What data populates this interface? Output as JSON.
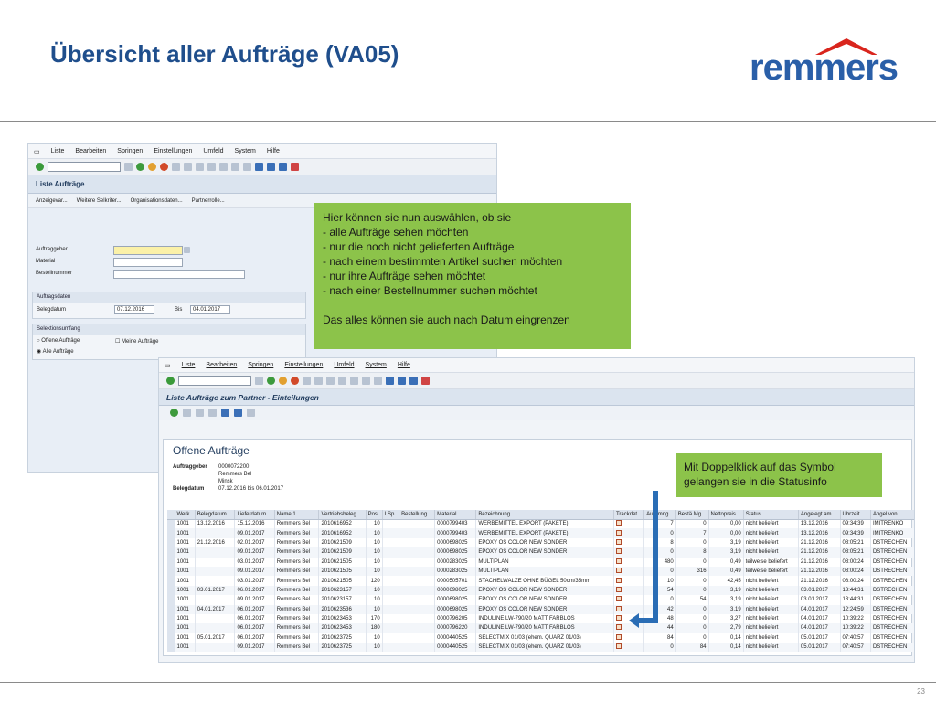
{
  "slide": {
    "title": "Übersicht aller Aufträge (VA05)",
    "logo": "remmers",
    "page_number": "23"
  },
  "sap1": {
    "menu": [
      "Liste",
      "Bearbeiten",
      "Springen",
      "Einstellungen",
      "Umfeld",
      "System",
      "Hilfe"
    ],
    "title": "Liste Aufträge",
    "appbar": [
      "Anzeigevar...",
      "Weitere Selkriter...",
      "Organisationsdaten...",
      "Partnerrolle..."
    ],
    "fields": {
      "auftraggeber_label": "Auftraggeber",
      "material_label": "Material",
      "bestellnummer_label": "Bestellnummer"
    },
    "auftragsdaten": {
      "title": "Auftragsdaten",
      "belegdatum_label": "Belegdatum",
      "from": "07.12.2016",
      "bis_label": "Bis",
      "to": "04.01.2017"
    },
    "selektion": {
      "title": "Selektionsumfang",
      "offene": "Offene Aufträge",
      "meine": "Meine Aufträge",
      "alle": "Alle Aufträge"
    }
  },
  "callout1": {
    "lines": [
      "Hier können sie nun auswählen, ob sie",
      "- alle Aufträge sehen möchten",
      "- nur die noch nicht gelieferten Aufträge",
      "- nach einem bestimmten Artikel suchen möchten",
      "- nur ihre Aufträge sehen möchtet",
      "- nach einer Bestellnummer suchen möchtet"
    ],
    "footer": "Das alles können sie auch nach Datum eingrenzen"
  },
  "callout2": {
    "text_line1": "Mit Doppelklick auf das Symbol",
    "text_line2": "gelangen sie in die Statusinfo"
  },
  "sap2": {
    "menu": [
      "Liste",
      "Bearbeiten",
      "Springen",
      "Einstellungen",
      "Umfeld",
      "System",
      "Hilfe"
    ],
    "title": "Liste Aufträge zum Partner - Einteilungen",
    "report_title": "Offene Aufträge",
    "auftraggeber_label": "Auftraggeber",
    "auftraggeber_value": "0000072200",
    "auftraggeber_name": "Remmers Bel",
    "auftraggeber_city": "Minsk",
    "belegdatum_label": "Belegdatum",
    "belegdatum_value": "07.12.2016 bis 06.01.2017",
    "columns": [
      "Werk",
      "Belegdatum",
      "Lieferdatum",
      "Name 1",
      "Vertriebsbeleg",
      "Pos",
      "LSp",
      "Bestellung",
      "Material",
      "Bezeichnung",
      "Trackdet",
      "Auftrmng",
      "Bestä.Mg",
      "Nettopreis",
      "Status",
      "Angelegt am",
      "Uhrzeit",
      "Angel.von"
    ],
    "rows": [
      [
        "1001",
        "13.12.2016",
        "15.12.2016",
        "Remmers Bel",
        "2010616952",
        "10",
        "",
        "",
        "0000799403",
        "WERBEMITTEL EXPORT (PAKETE)",
        "",
        "7",
        "0",
        "0,00",
        "nicht beliefert",
        "13.12.2016",
        "09:34:39",
        "IMITRENKO"
      ],
      [
        "1001",
        "",
        "09.01.2017",
        "Remmers Bel",
        "2010616952",
        "10",
        "",
        "",
        "0000799403",
        "WERBEMITTEL EXPORT (PAKETE)",
        "",
        "0",
        "7",
        "0,00",
        "nicht beliefert",
        "13.12.2016",
        "09:34:39",
        "IMITRENKO"
      ],
      [
        "1001",
        "21.12.2016",
        "02.01.2017",
        "Remmers Bel",
        "2010621509",
        "10",
        "",
        "",
        "0000698025",
        "EPOXY OS COLOR NEW SONDER",
        "",
        "8",
        "0",
        "3,19",
        "nicht beliefert",
        "21.12.2016",
        "08:05:21",
        "DSTRECHEN"
      ],
      [
        "1001",
        "",
        "09.01.2017",
        "Remmers Bel",
        "2010621509",
        "10",
        "",
        "",
        "0000698025",
        "EPOXY OS COLOR NEW SONDER",
        "",
        "0",
        "8",
        "3,19",
        "nicht beliefert",
        "21.12.2016",
        "08:05:21",
        "DSTRECHEN"
      ],
      [
        "1001",
        "",
        "03.01.2017",
        "Remmers Bel",
        "2010621505",
        "10",
        "",
        "",
        "0000283025",
        "MULTIPLAN",
        "",
        "480",
        "0",
        "0,49",
        "teilweise beliefert",
        "21.12.2016",
        "08:00:24",
        "DSTRECHEN"
      ],
      [
        "1001",
        "",
        "09.01.2017",
        "Remmers Bel",
        "2010621505",
        "10",
        "",
        "",
        "0000283025",
        "MULTIPLAN",
        "",
        "0",
        "316",
        "0,49",
        "teilweise beliefert",
        "21.12.2016",
        "08:00:24",
        "DSTRECHEN"
      ],
      [
        "1001",
        "",
        "03.01.2017",
        "Remmers Bel",
        "2010621505",
        "120",
        "",
        "",
        "0000505701",
        "STACHELWALZE OHNE BÜGEL 50cm/35mm",
        "",
        "10",
        "0",
        "42,45",
        "nicht beliefert",
        "21.12.2016",
        "08:00:24",
        "DSTRECHEN"
      ],
      [
        "1001",
        "03.01.2017",
        "06.01.2017",
        "Remmers Bel",
        "2010623157",
        "10",
        "",
        "",
        "0000698025",
        "EPOXY OS COLOR NEW SONDER",
        "",
        "54",
        "0",
        "3,19",
        "nicht beliefert",
        "03.01.2017",
        "13:44:31",
        "DSTRECHEN"
      ],
      [
        "1001",
        "",
        "09.01.2017",
        "Remmers Bel",
        "2010623157",
        "10",
        "",
        "",
        "0000698025",
        "EPOXY OS COLOR NEW SONDER",
        "",
        "0",
        "54",
        "3,19",
        "nicht beliefert",
        "03.01.2017",
        "13:44:31",
        "DSTRECHEN"
      ],
      [
        "1001",
        "04.01.2017",
        "06.01.2017",
        "Remmers Bel",
        "2010623536",
        "10",
        "",
        "",
        "0000698025",
        "EPOXY OS COLOR NEW SONDER",
        "",
        "42",
        "0",
        "3,19",
        "nicht beliefert",
        "04.01.2017",
        "12:24:59",
        "DSTRECHEN"
      ],
      [
        "1001",
        "",
        "06.01.2017",
        "Remmers Bel",
        "2010623453",
        "170",
        "",
        "",
        "0000796205",
        "INDULINE LW-790/20 MATT FARBLOS",
        "",
        "48",
        "0",
        "3,27",
        "nicht beliefert",
        "04.01.2017",
        "10:39:22",
        "DSTRECHEN"
      ],
      [
        "1001",
        "",
        "06.01.2017",
        "Remmers Bel",
        "2010623453",
        "180",
        "",
        "",
        "0000796220",
        "INDULINE LW-790/20 MATT FARBLOS",
        "",
        "44",
        "0",
        "2,79",
        "nicht beliefert",
        "04.01.2017",
        "10:39:22",
        "DSTRECHEN"
      ],
      [
        "1001",
        "05.01.2017",
        "06.01.2017",
        "Remmers Bel",
        "2010623725",
        "10",
        "",
        "",
        "0000440525",
        "SELECTMIX 01/03 (ehem. QUARZ 01/03)",
        "",
        "84",
        "0",
        "0,14",
        "nicht beliefert",
        "05.01.2017",
        "07:40:57",
        "DSTRECHEN"
      ],
      [
        "1001",
        "",
        "09.01.2017",
        "Remmers Bel",
        "2010623725",
        "10",
        "",
        "",
        "0000440525",
        "SELECTMIX 01/03 (ehem. QUARZ 01/03)",
        "",
        "0",
        "84",
        "0,14",
        "nicht beliefert",
        "05.01.2017",
        "07:40:57",
        "DSTRECHEN"
      ]
    ]
  }
}
